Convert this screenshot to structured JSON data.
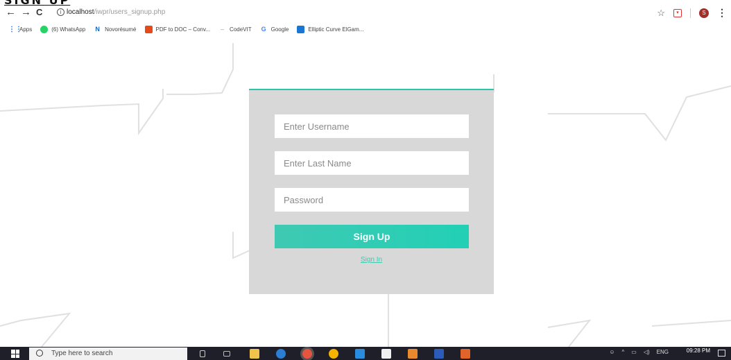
{
  "heading": "SIGN UP",
  "browser": {
    "nav": {
      "back": "←",
      "forward": "→",
      "reload": "C"
    },
    "url_host": "localhost",
    "url_path": "/iwpr/users_signup.php",
    "avatar_letter": "S"
  },
  "bookmarks": [
    {
      "label": "Apps",
      "icon": "apps-grid-icon"
    },
    {
      "label": "(6) WhatsApp",
      "icon": "whatsapp-icon"
    },
    {
      "label": "Novorésumé",
      "icon": "novoresume-icon"
    },
    {
      "label": "PDF to DOC – Conv...",
      "icon": "pdf-icon"
    },
    {
      "label": "CodeVIT",
      "icon": "codevit-icon"
    },
    {
      "label": "Google",
      "icon": "google-icon"
    },
    {
      "label": "Elliptic Curve ElGam...",
      "icon": "bookmark-icon"
    }
  ],
  "form": {
    "username_placeholder": "Enter Username",
    "lastname_placeholder": "Enter Last Name",
    "password_placeholder": "Password",
    "submit_label": "Sign Up",
    "signin_label": "Sign In"
  },
  "taskbar": {
    "search_placeholder": "Type here to search",
    "language": "ENG",
    "time": "09:28 PM"
  },
  "colors": {
    "accent": "#2bc5a8",
    "panel_bg": "#d8d8d8",
    "taskbar_bg": "#1f1f2a"
  }
}
